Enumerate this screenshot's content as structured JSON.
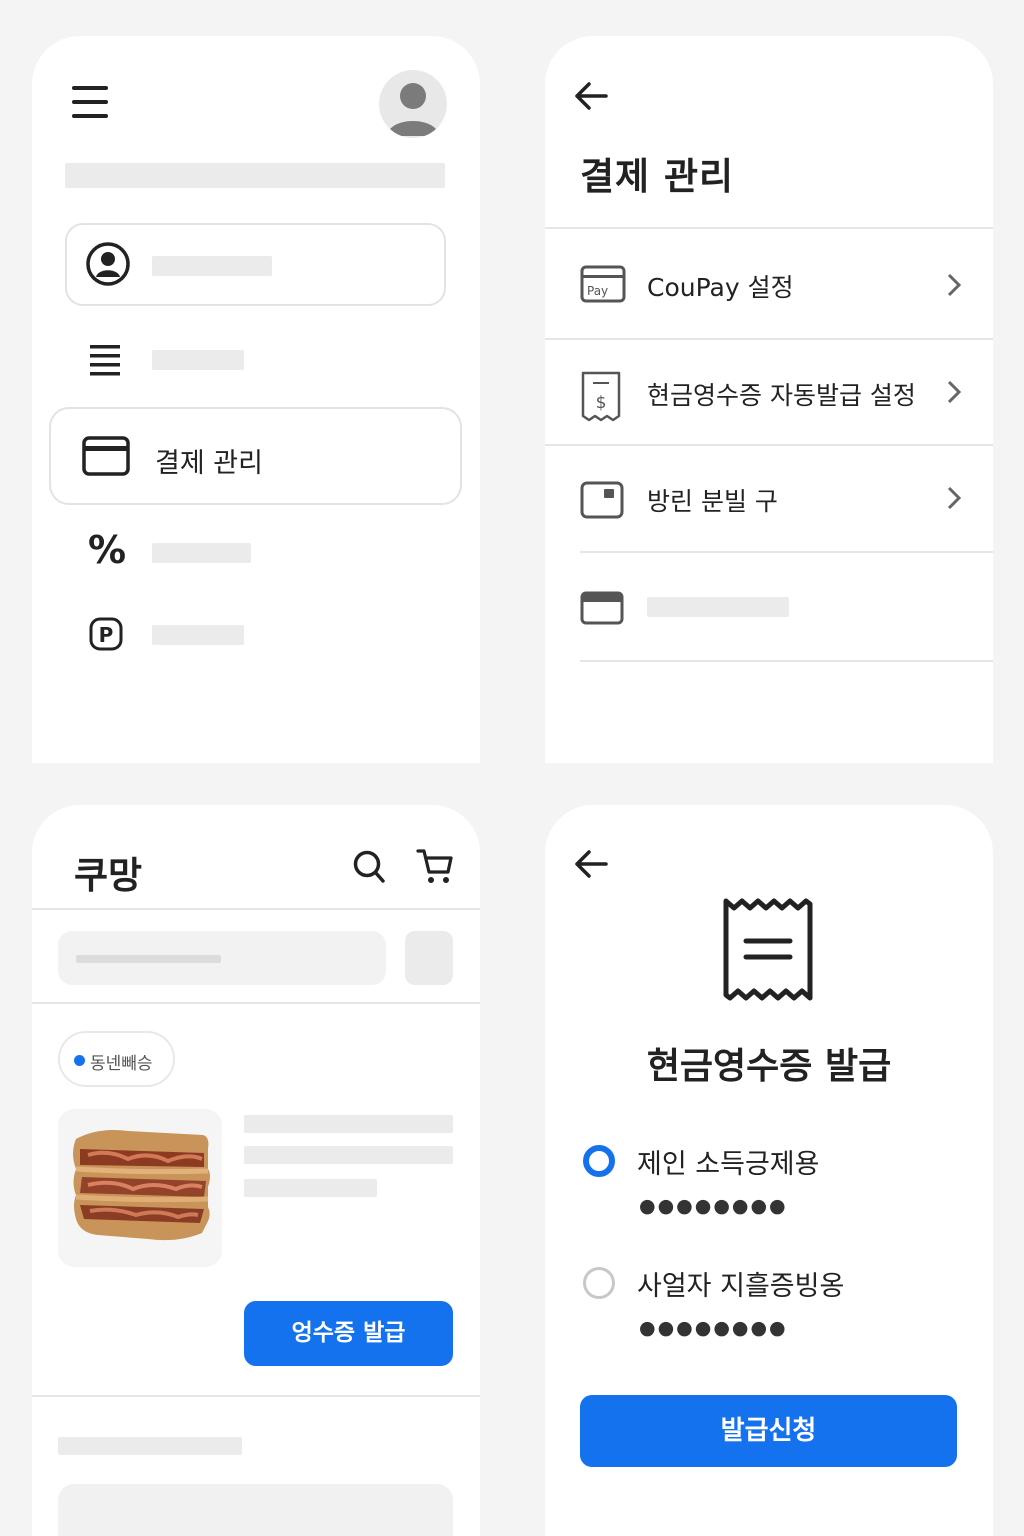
{
  "panel_menu": {
    "active_item_label": "결제 관리"
  },
  "panel_payment": {
    "title": "결제 관리",
    "items": [
      {
        "icon": "coupay-card-icon",
        "icon_text": "Pay",
        "label": "CouPay 설정"
      },
      {
        "icon": "receipt-dollar-icon",
        "icon_text": "$",
        "label": "현금영수증 자동발급 설정"
      },
      {
        "icon": "wallet-icon",
        "label": "방린 분빌 구"
      }
    ]
  },
  "panel_shop": {
    "logo": "쿠망",
    "badge": "동넨빼승",
    "receipt_button": "엉수증 발급"
  },
  "panel_receipt": {
    "title": "현금영수증 발급",
    "options": [
      {
        "label": "제인 소득긍제용",
        "selected": true,
        "masked": "●●●●●●●●"
      },
      {
        "label": "사얼자 지흘증빙옹",
        "selected": false,
        "masked": "●●●●●●●●"
      }
    ],
    "apply_button": "발급신청"
  },
  "colors": {
    "accent": "#1572ef",
    "placeholder": "#ebebeb",
    "background": "#f4f4f5"
  }
}
